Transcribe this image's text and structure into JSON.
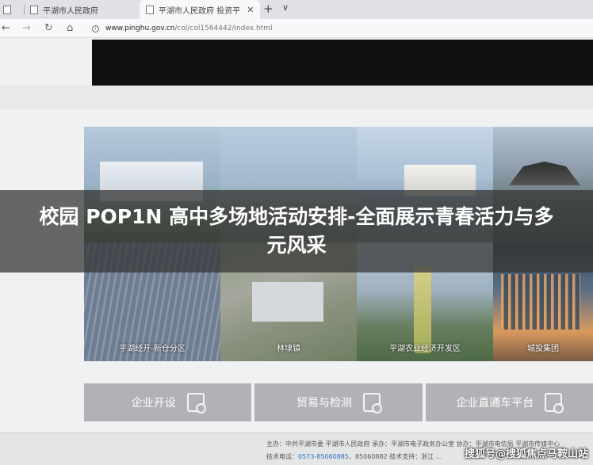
{
  "browser": {
    "tabs": [
      {
        "label": "平湖市人民政府",
        "active": false
      },
      {
        "label": "平湖市人民政府 投资平",
        "active": true
      }
    ],
    "address": {
      "host": "www.pinghu.gov.cn",
      "path": "/col/col1564442/index.html"
    },
    "new_tab_glyph": "+",
    "menu_glyph": "∨",
    "close_glyph": "✕"
  },
  "overlay": {
    "title": "校园 POP1N 高中多场地活动安排-全面展示青春活力与多元风采"
  },
  "tiles": [
    {
      "label": ""
    },
    {
      "label": ""
    },
    {
      "label": ""
    },
    {
      "label": ""
    },
    {
      "label": "平湖经开-新仓分区"
    },
    {
      "label": "林埭镇"
    },
    {
      "label": "平湖农业经济开发区"
    },
    {
      "label": "城投集团"
    }
  ],
  "services": [
    {
      "label": "企业开设",
      "icon": "document-search-icon"
    },
    {
      "label": "贸易与检测",
      "icon": "checklist-icon"
    },
    {
      "label": "企业直通车平台",
      "icon": "document-check-icon"
    }
  ],
  "footer": {
    "line1": "主办：中共平湖市委 平湖市人民政府 承办：平湖市电子政务办公室 协办：平湖市电信局 平湖市传媒中心",
    "line2_prefix": "技术电话：",
    "phone": "0573-85060885",
    "line2_suffix": "、85060882 技术支持：浙江 …"
  },
  "watermark": "搜狐号@搜狐焦点马鞍山站"
}
